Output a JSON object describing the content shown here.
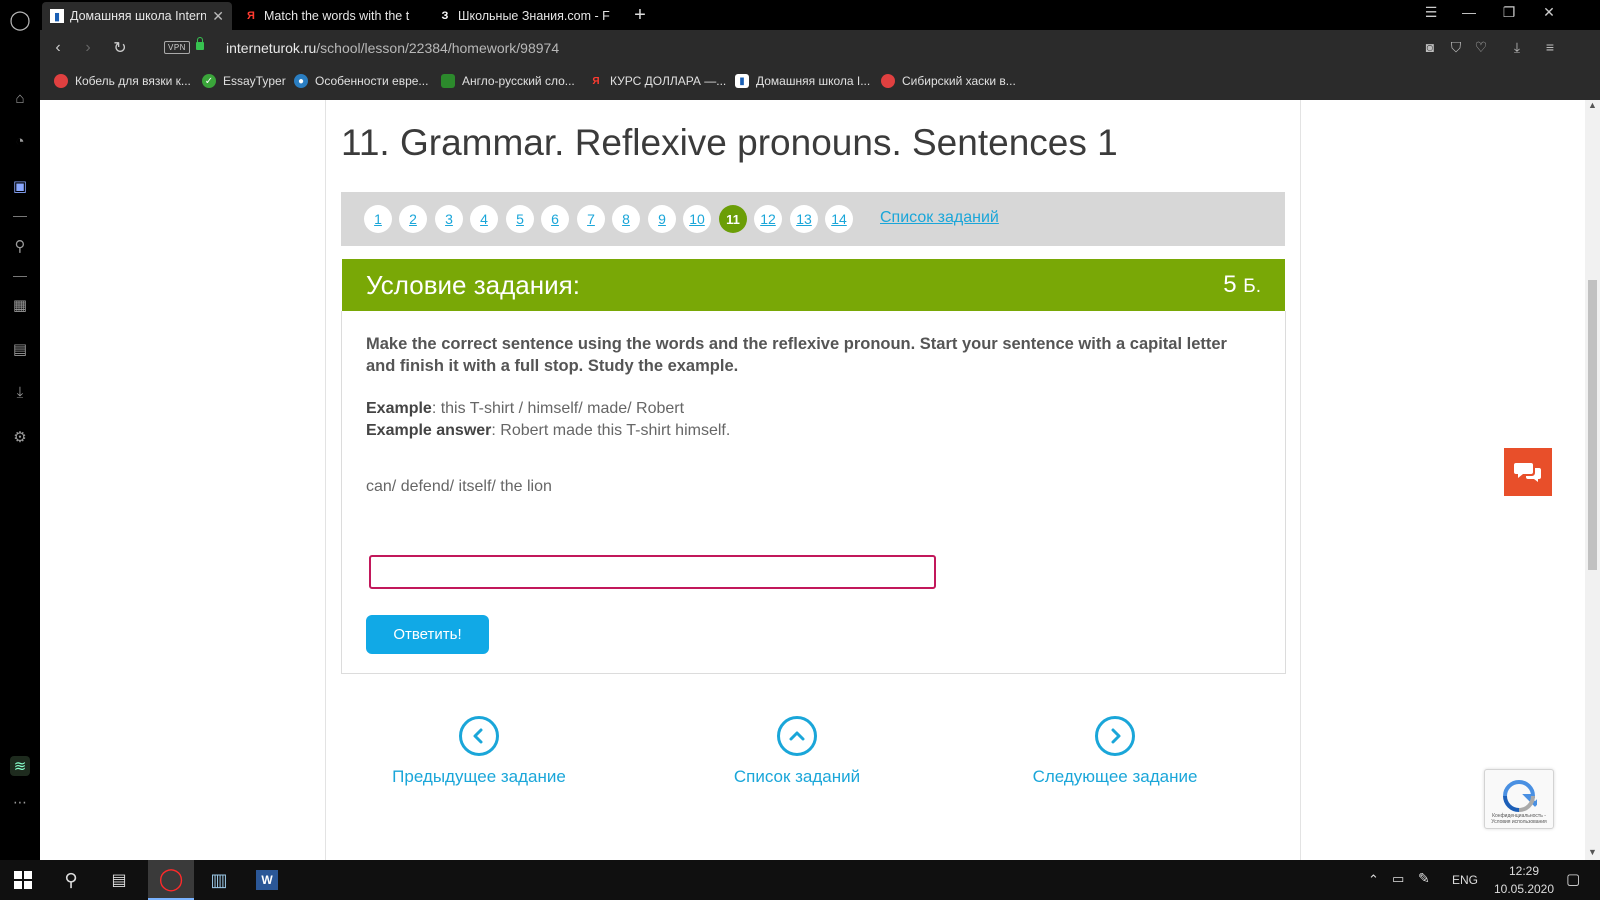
{
  "browser": {
    "tabs": [
      {
        "title": "Домашняя школа Interne",
        "icon": "book-icon",
        "active": true
      },
      {
        "title": "Match the words with the t",
        "icon": "yandex-icon",
        "active": false
      },
      {
        "title": "Школьные Знания.com - F",
        "icon": "znania-icon",
        "active": false
      }
    ],
    "new_tab": "+",
    "url_domain": "interneturok.ru",
    "url_path": "/school/lesson/22384/homework/98974",
    "vpn_label": "VPN",
    "bookmarks": [
      {
        "label": "Кобель для вязки к...",
        "icon": "google-apps-icon"
      },
      {
        "label": "EssayTyper",
        "icon": "check-circle-icon"
      },
      {
        "label": "Особенности евре...",
        "icon": "globe-icon"
      },
      {
        "label": "Англо-русский сло...",
        "icon": "green-square-icon"
      },
      {
        "label": "КУРС ДОЛЛАРА —...",
        "icon": "yandex-icon"
      },
      {
        "label": "Домашняя школа I...",
        "icon": "book-icon"
      },
      {
        "label": "Сибирский хаски в...",
        "icon": "google-apps-icon"
      }
    ]
  },
  "page": {
    "title": "11. Grammar. Reflexive pronouns. Sentences 1",
    "task_numbers": [
      "1",
      "2",
      "3",
      "4",
      "5",
      "6",
      "7",
      "8",
      "9",
      "10",
      "11",
      "12",
      "13",
      "14"
    ],
    "current_task": "11",
    "task_list_link": "Список заданий",
    "task_header": "Условие задания:",
    "points_value": "5",
    "points_unit": "Б.",
    "instruction": "Make the correct sentence using the words and the reflexive pronoun. Start your sentence with a capital letter and finish it with a full stop. Study the example.",
    "example_label": "Example",
    "example_text": ": this T-shirt / himself/ made/ Robert",
    "example_answer_label": "Example answer",
    "example_answer_text": ": Robert made this T-shirt himself.",
    "prompt": "can/ defend/ itself/ the lion",
    "answer_value": "",
    "submit_label": "Ответить!",
    "prev_label": "Предыдущее задание",
    "list_label": "Список заданий",
    "next_label": "Следующее задание",
    "recaptcha_text": "Конфиденциальность - Условия использования"
  },
  "taskbar": {
    "language": "ENG",
    "time": "12:29",
    "date": "10.05.2020"
  },
  "colors": {
    "accent_green": "#79a806",
    "current_badge": "#6b9e07",
    "link_blue": "#1aa6d9",
    "button_blue": "#11a9e6",
    "input_border": "#c2185b",
    "chat_orange": "#e84f2a"
  }
}
